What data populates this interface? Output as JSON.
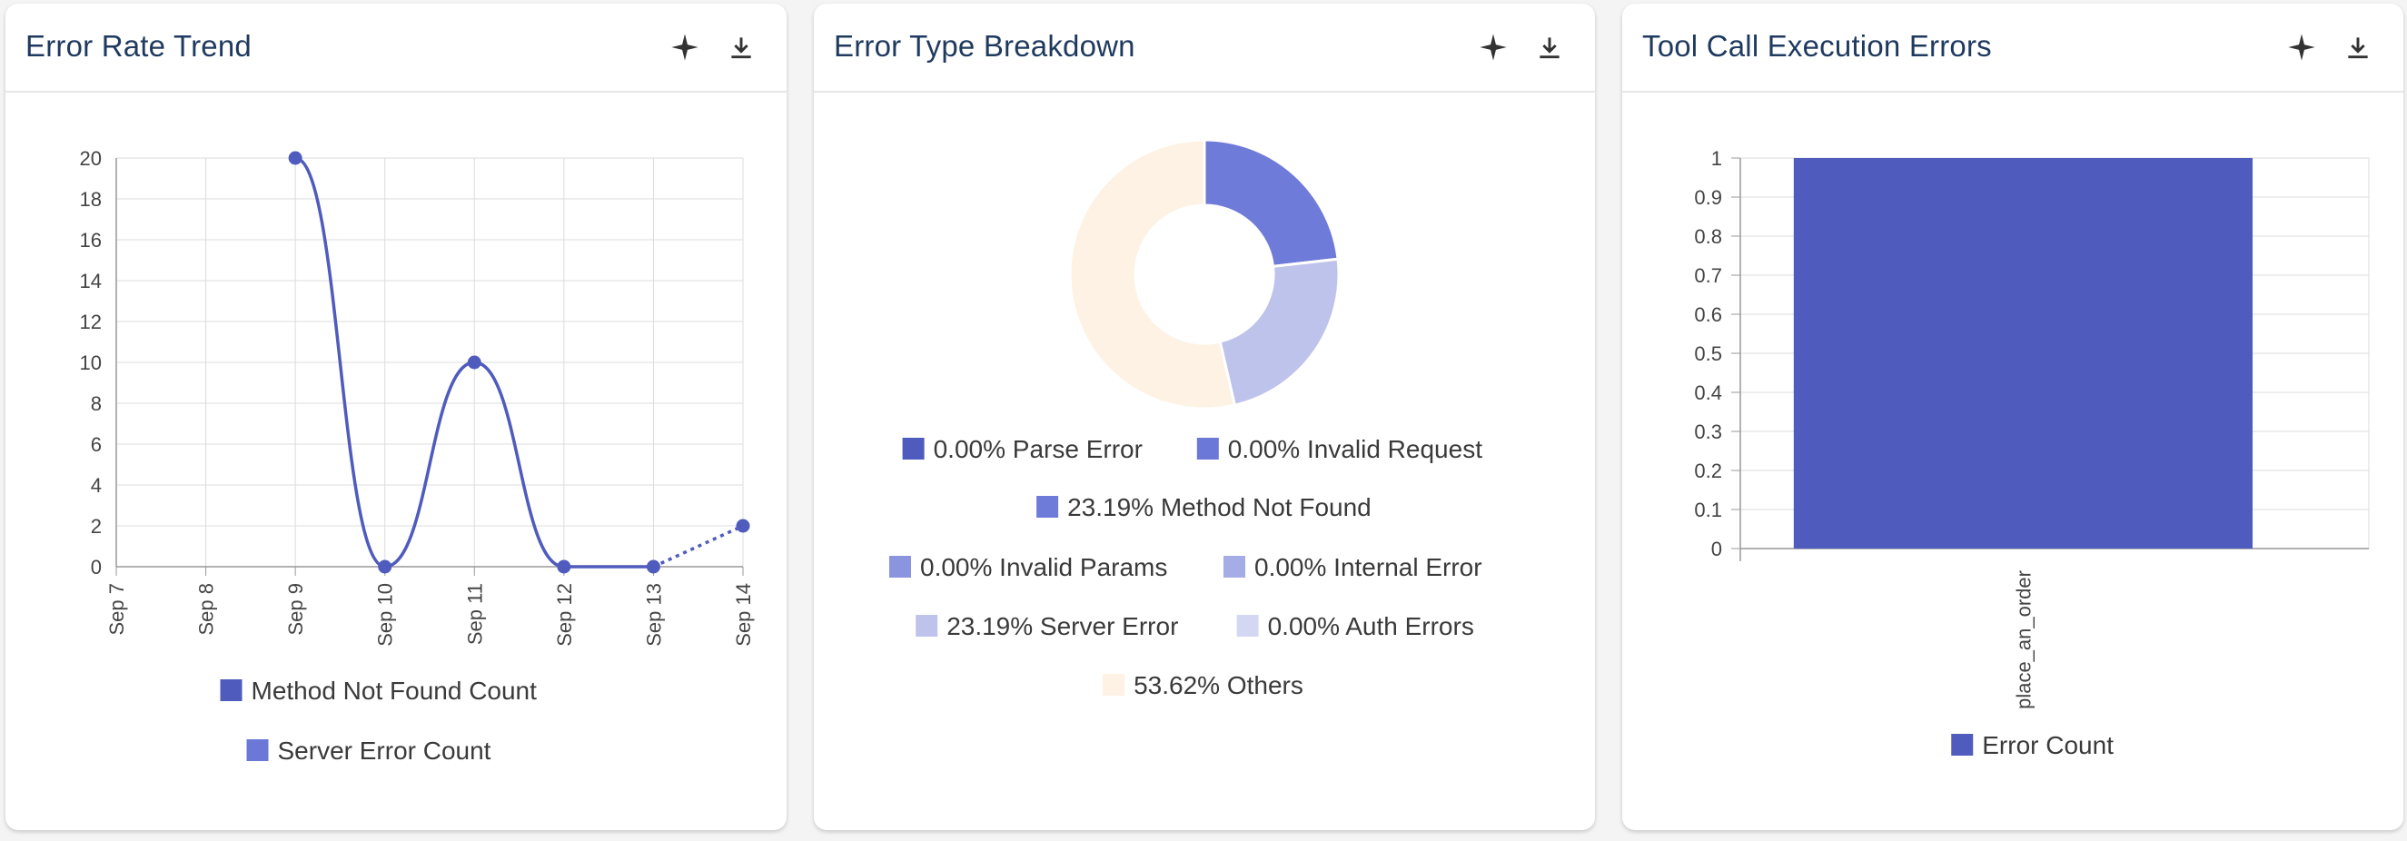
{
  "colors": {
    "indigo": "#4f5bbd",
    "series2": "#6b78d6",
    "grid": "#dcdcdc",
    "others": "#fdf2e3"
  },
  "icons": {
    "insight": "sparkle-icon",
    "download": "download-icon"
  },
  "cards": [
    {
      "title": "Error Rate Trend",
      "chart_data": {
        "type": "line",
        "x": [
          "Sep 7",
          "Sep 8",
          "Sep 9",
          "Sep 10",
          "Sep 11",
          "Sep 12",
          "Sep 13",
          "Sep 14"
        ],
        "series": [
          {
            "name": "Method Not Found Count",
            "values": [
              null,
              null,
              20,
              0,
              10,
              0,
              0,
              2
            ]
          },
          {
            "name": "Server Error Count",
            "values": [
              null,
              null,
              null,
              null,
              null,
              null,
              null,
              null
            ]
          }
        ],
        "yticks": [
          "0",
          "2",
          "4",
          "6",
          "8",
          "10",
          "12",
          "14",
          "16",
          "18",
          "20"
        ],
        "ylim": [
          0,
          20
        ],
        "grid": true,
        "legend": "bottom"
      }
    },
    {
      "title": "Error Type Breakdown",
      "chart_data": {
        "type": "pie",
        "slices": [
          {
            "label": "0.00% Parse Error",
            "value": 0.0,
            "color": "#4f5bbd"
          },
          {
            "label": "0.00% Invalid Request",
            "value": 0.0,
            "color": "#6b78d6"
          },
          {
            "label": "23.19% Method Not Found",
            "value": 23.19,
            "color": "#6f7bd9"
          },
          {
            "label": "0.00% Invalid Params",
            "value": 0.0,
            "color": "#8a94df"
          },
          {
            "label": "0.00% Internal Error",
            "value": 0.0,
            "color": "#a5ade6"
          },
          {
            "label": "23.19% Server Error",
            "value": 23.19,
            "color": "#bec3ec"
          },
          {
            "label": "0.00% Auth Errors",
            "value": 0.0,
            "color": "#d4d7f2"
          },
          {
            "label": "53.62% Others",
            "value": 53.62,
            "color": "#fdf2e3"
          }
        ],
        "legend": "bottom"
      }
    },
    {
      "title": "Tool Call Execution Errors",
      "chart_data": {
        "type": "bar",
        "categories": [
          "place_an_order"
        ],
        "series": [
          {
            "name": "Error Count",
            "values": [
              1
            ]
          }
        ],
        "yticks": [
          "0",
          "0.1",
          "0.2",
          "0.3",
          "0.4",
          "0.5",
          "0.6",
          "0.7",
          "0.8",
          "0.9",
          "1"
        ],
        "ylim": [
          0,
          1
        ],
        "grid": true,
        "legend": "bottom"
      }
    }
  ]
}
